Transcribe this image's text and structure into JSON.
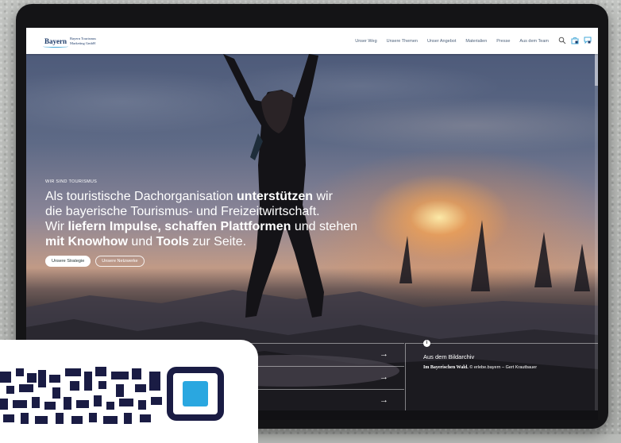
{
  "header": {
    "logo_word": "Bayern",
    "logo_sub_line1": "Bayern Tourismus",
    "logo_sub_line2": "Marketing GmbH",
    "nav": [
      "Unser Weg",
      "Unsere Themen",
      "Unser Angebot",
      "Materialien",
      "Presse",
      "Aus dem Team"
    ],
    "icons": [
      "search-icon",
      "briefcase-icon",
      "chat-icon"
    ]
  },
  "hero": {
    "eyebrow": "WIR SIND TOURISMUS",
    "line1_pre": "Als touristische Dachorganisation ",
    "line1_bold": "unterstützen",
    "line1_post": " wir",
    "line2": "die bayerische Tourismus- und Freizeitwirtschaft.",
    "line3_pre": "Wir ",
    "line3_bold1": "liefern Impulse",
    "line3_mid1": ", ",
    "line3_bold2": "schaffen Plattformen",
    "line3_post": " und stehen",
    "line4_bold1": "mit Knowhow",
    "line4_mid": " und ",
    "line4_bold2": "Tools",
    "line4_post": " zur Seite.",
    "btn_primary": "Unsere Strategie",
    "btn_secondary": "Unsere Netzwerke"
  },
  "links": {
    "arrows": [
      "→",
      "→",
      "→"
    ]
  },
  "archive": {
    "badge": "i",
    "title": "Aus dem Bildarchiv",
    "caption_bold": "Im Bayerischen Wald.",
    "caption_rest": " © erlebe.bayern – Gert Krautbauer"
  },
  "colors": {
    "brand_navy": "#1d3b6a",
    "brand_sky": "#46a8d8",
    "qr_dark": "#1a1c44",
    "qr_accent": "#2aa7e0"
  }
}
